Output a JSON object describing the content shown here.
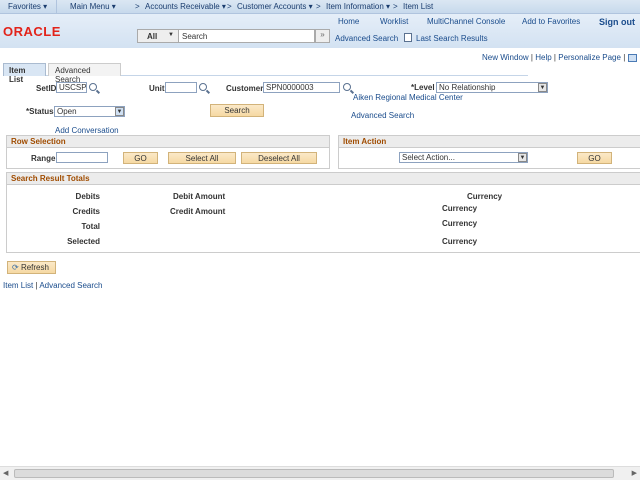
{
  "breadcrumb": {
    "favorites": "Favorites ▾",
    "main_menu": "Main Menu ▾",
    "items": [
      "Accounts Receivable ▾",
      "Customer Accounts ▾",
      "Item Information ▾",
      "Item List"
    ],
    "sep": ">"
  },
  "header": {
    "logo": "ORACLE",
    "links": [
      "Home",
      "Worklist",
      "MultiChannel Console",
      "Add to Favorites",
      "Sign out"
    ],
    "search_scope": "All",
    "search_placeholder": "Search",
    "search_go": "»",
    "advanced_search": "Advanced Search",
    "last_results": "Last Search Results"
  },
  "pagelinks": {
    "new_window": "New Window",
    "help": "Help",
    "personalize": "Personalize Page",
    "sep": "|"
  },
  "tabs": [
    "Item List",
    "Advanced Search"
  ],
  "form": {
    "setid_label": "SetID",
    "setid_value": "USCSP",
    "unit_label": "Unit",
    "unit_value": "",
    "customer_label": "Customer",
    "customer_value": "SPN0000003",
    "customer_name": "Aiken Regional Medical Center",
    "level_label": "*Level",
    "level_value": "No Relationship",
    "status_label": "*Status",
    "status_value": "Open",
    "search_button": "Search",
    "advanced_search": "Advanced Search",
    "add_conversation": "Add Conversation"
  },
  "row_selection": {
    "title": "Row Selection",
    "range_label": "Range",
    "range_value": "",
    "go": "GO",
    "select_all": "Select All",
    "deselect_all": "Deselect All"
  },
  "item_action": {
    "title": "Item Action",
    "select_value": "Select Action...",
    "go": "GO"
  },
  "totals": {
    "title": "Search Result Totals",
    "rows": [
      {
        "label": "Debits",
        "amount": "Debit Amount",
        "currency": "Currency"
      },
      {
        "label": "Credits",
        "amount": "Credit Amount",
        "currency": "Currency"
      },
      {
        "label": "Total",
        "amount": "",
        "currency": "Currency"
      },
      {
        "label": "Selected",
        "amount": "",
        "currency": "Currency"
      }
    ]
  },
  "refresh": "Refresh",
  "footer": {
    "item_list": "Item List",
    "sep": "|",
    "advanced_search": "Advanced Search"
  }
}
